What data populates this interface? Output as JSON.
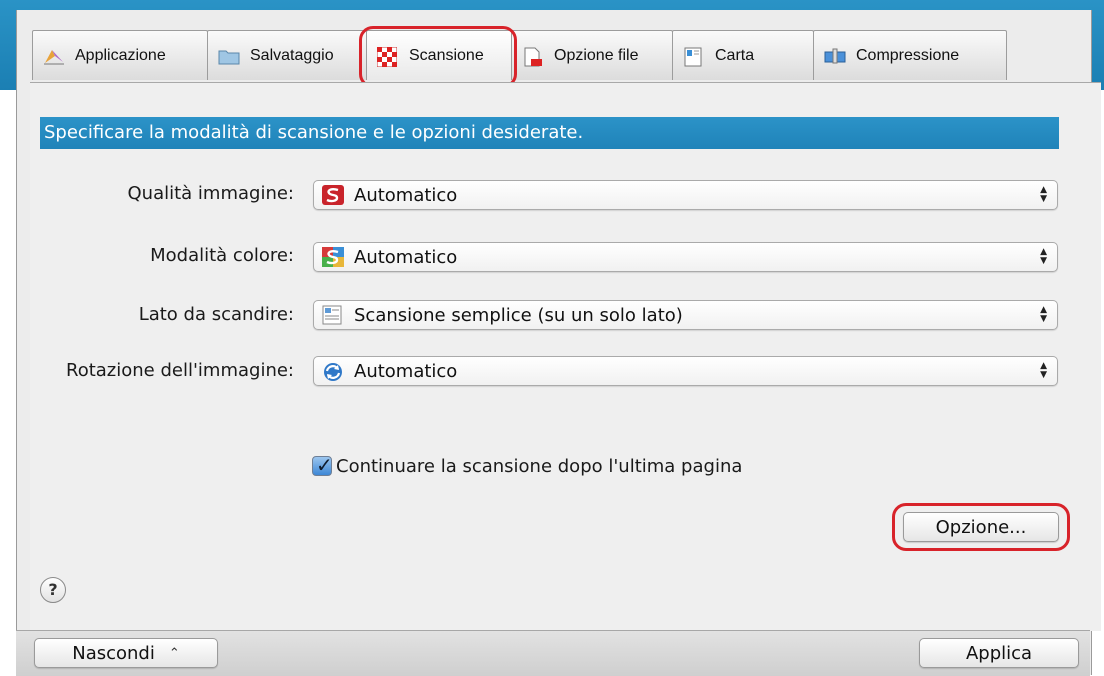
{
  "tabs": [
    {
      "label": "Applicazione",
      "icon": "application-icon"
    },
    {
      "label": "Salvataggio",
      "icon": "folder-icon"
    },
    {
      "label": "Scansione",
      "icon": "scan-icon"
    },
    {
      "label": "Opzione file",
      "icon": "file-option-icon"
    },
    {
      "label": "Carta",
      "icon": "paper-icon"
    },
    {
      "label": "Compressione",
      "icon": "compression-icon"
    }
  ],
  "active_tab": "Scansione",
  "banner": "Specificare la modalità di scansione e le opzioni desiderate.",
  "fields": {
    "quality": {
      "label": "Qualità immagine:",
      "value": "Automatico",
      "icon": "scansnap-red-icon"
    },
    "color": {
      "label": "Modalità colore:",
      "value": "Automatico",
      "icon": "scansnap-color-icon"
    },
    "side": {
      "label": "Lato da scandire:",
      "value": "Scansione semplice (su un solo lato)",
      "icon": "single-page-icon"
    },
    "rotation": {
      "label": "Rotazione dell'immagine:",
      "value": "Automatico",
      "icon": "rotation-icon"
    }
  },
  "continue_scan": {
    "label": "Continuare la scansione dopo l'ultima pagina",
    "checked": true
  },
  "option_button": "Opzione...",
  "help": "?",
  "hide_button": "Nascondi",
  "apply_button": "Applica",
  "colors": {
    "accent": "#1f83b9",
    "highlight": "#d8232a"
  }
}
